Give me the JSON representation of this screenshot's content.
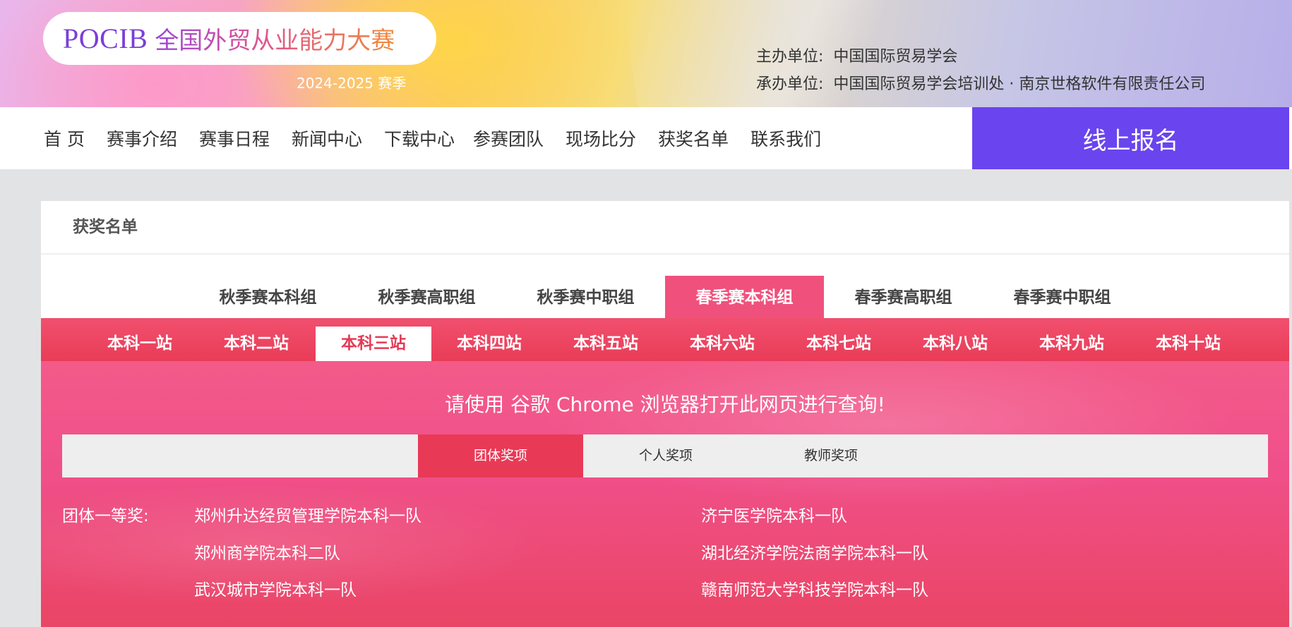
{
  "header": {
    "logo_en": "POCIB",
    "logo_cn": "全国外贸从业能力大赛",
    "season": "2024-2025 赛季",
    "organizer_key": "主办单位:",
    "organizer_value": "中国国际贸易学会",
    "host_key": "承办单位:",
    "host_value": "中国国际贸易学会培训处 · 南京世格软件有限责任公司"
  },
  "nav": {
    "items": [
      "首 页",
      "赛事介绍",
      "赛事日程",
      "新闻中心",
      "下载中心",
      "参赛团队",
      "现场比分",
      "获奖名单",
      "联系我们"
    ],
    "register_label": "线上报名"
  },
  "breadcrumb": "获奖名单",
  "season_tabs": [
    "秋季赛本科组",
    "秋季赛高职组",
    "秋季赛中职组",
    "春季赛本科组",
    "春季赛高职组",
    "春季赛中职组"
  ],
  "season_tabs_active": "春季赛本科组",
  "station_tabs": [
    "本科一站",
    "本科二站",
    "本科三站",
    "本科四站",
    "本科五站",
    "本科六站",
    "本科七站",
    "本科八站",
    "本科九站",
    "本科十站"
  ],
  "station_tabs_active": "本科三站",
  "notice": "请使用 谷歌 Chrome 浏览器打开此网页进行查询!",
  "award_tabs": [
    "团体奖项",
    "个人奖项",
    "教师奖项"
  ],
  "award_tabs_active": "团体奖项",
  "results": {
    "first_prize_label": "团体一等奖:",
    "teams": [
      "郑州升达经贸管理学院本科一队",
      "济宁医学院本科一队",
      "郑州商学院本科二队",
      "湖北经济学院法商学院本科一队",
      "武汉城市学院本科一队",
      "赣南师范大学科技学院本科一队"
    ]
  },
  "colors": {
    "accent_pink": "#f0517c",
    "station_red": "#e93c57",
    "register_purple": "#6a44ee"
  }
}
